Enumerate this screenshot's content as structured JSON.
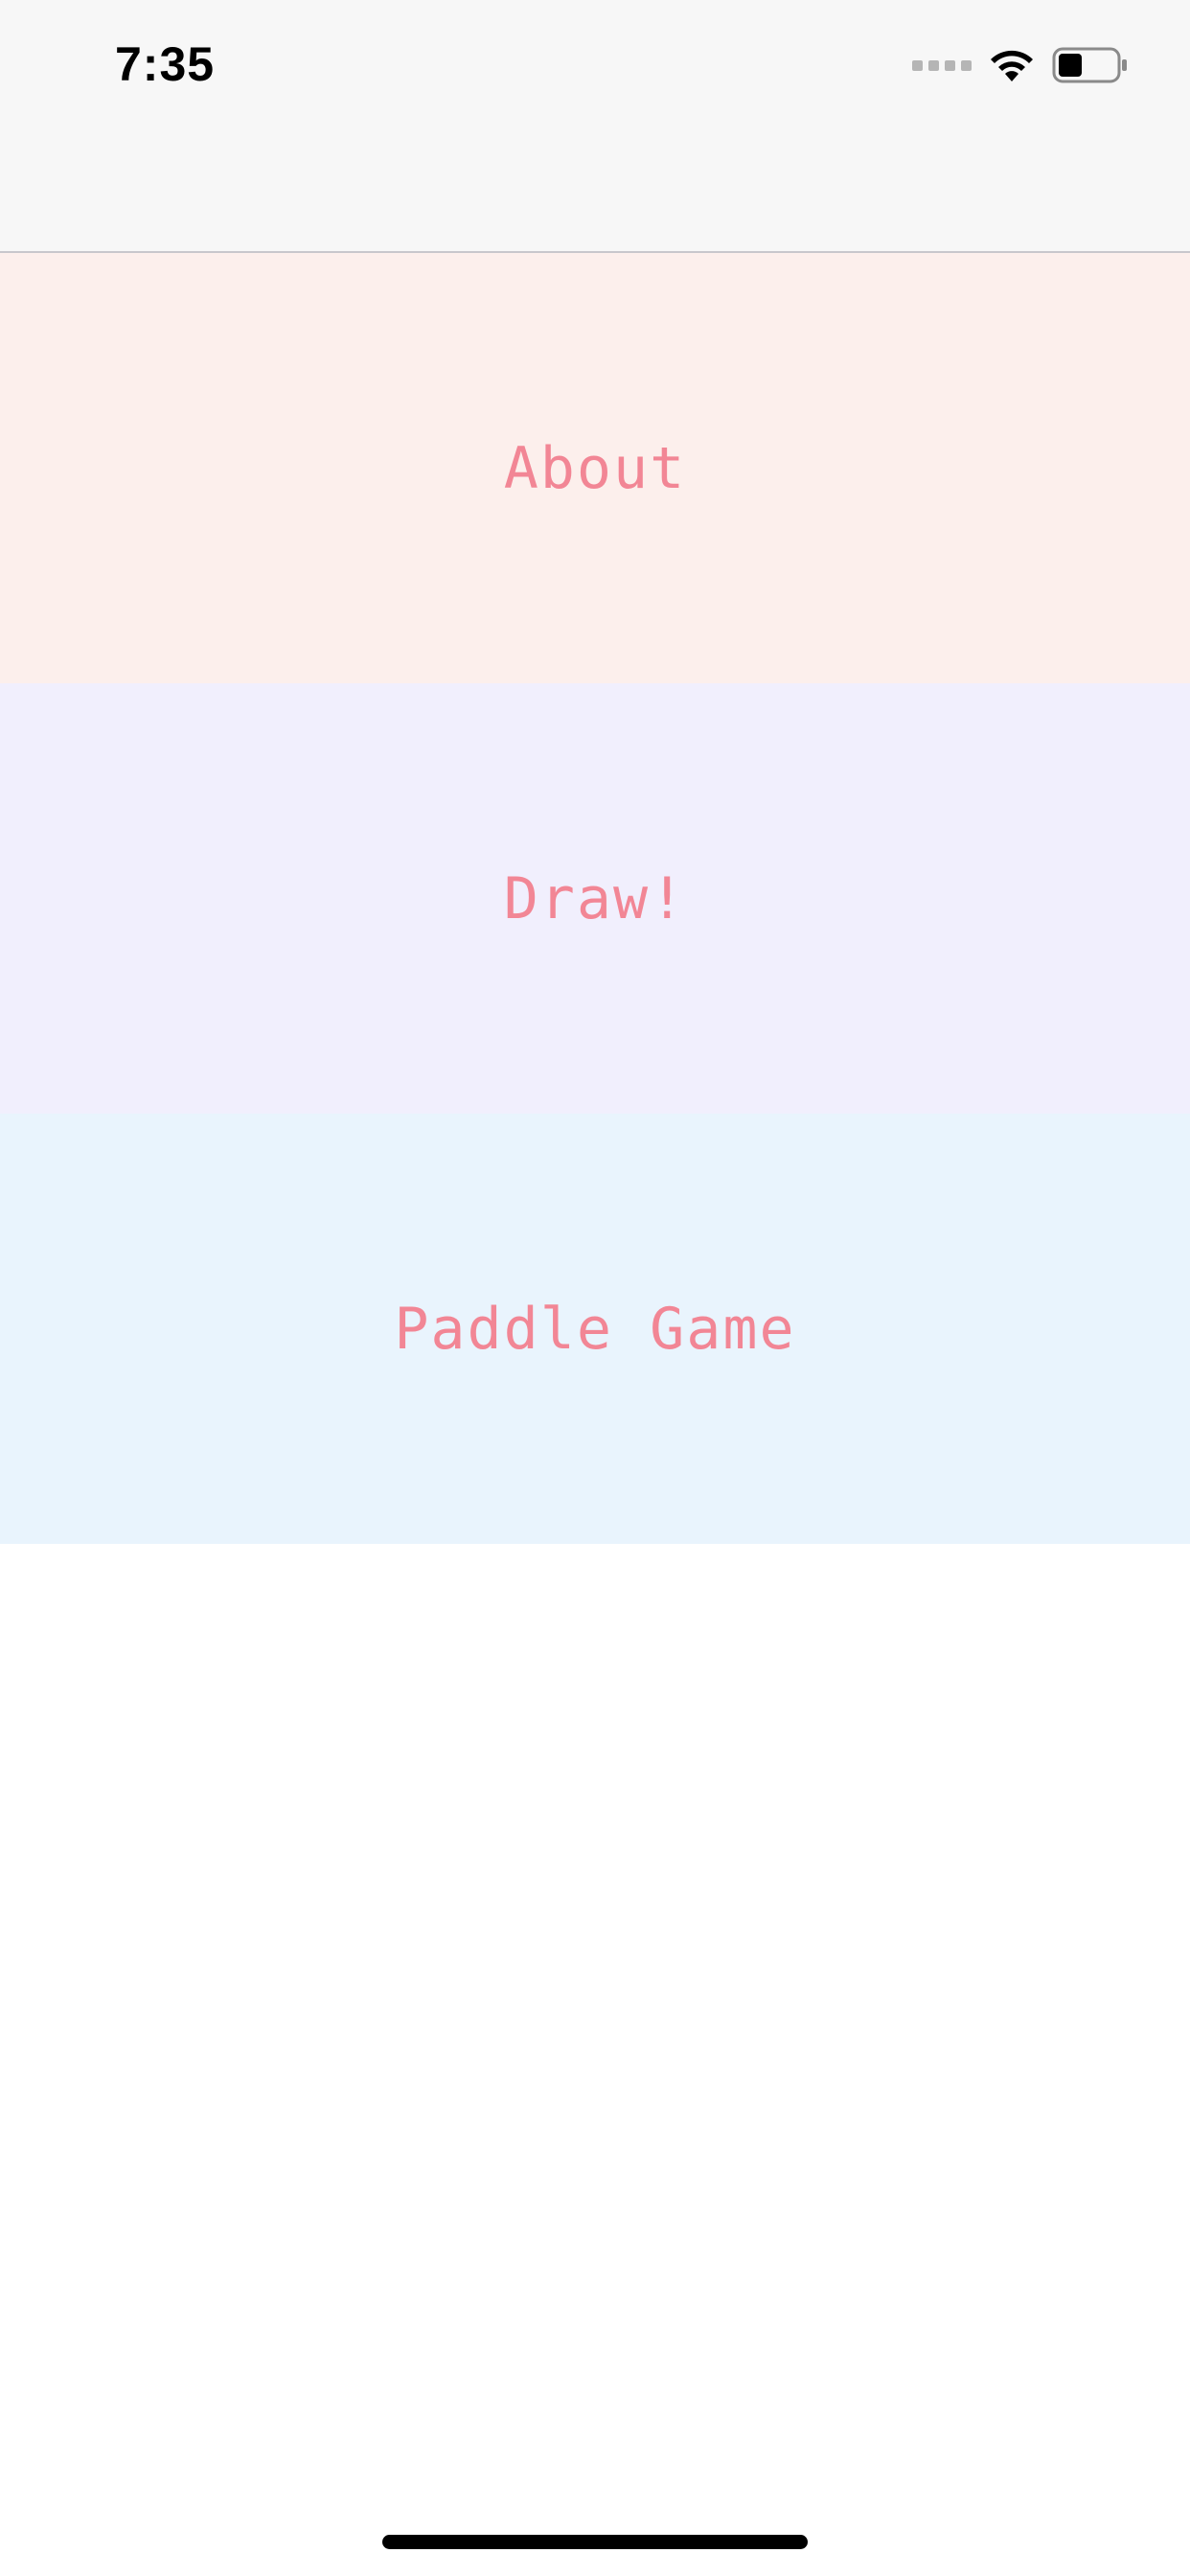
{
  "status_bar": {
    "time": "7:35",
    "icons": [
      "cellular-signal-icon",
      "wifi-icon",
      "battery-icon"
    ]
  },
  "colors": {
    "nav_background": "#f7f7f7",
    "label_color": "#f28695",
    "about_background": "#fcefec",
    "draw_background": "#f1effd",
    "paddle_background": "#e9f4fd"
  },
  "menu": {
    "items": [
      {
        "label": "About",
        "background": "#fcefec"
      },
      {
        "label": "Draw!",
        "background": "#f1effd"
      },
      {
        "label": "Paddle Game",
        "background": "#e9f4fd"
      }
    ]
  }
}
